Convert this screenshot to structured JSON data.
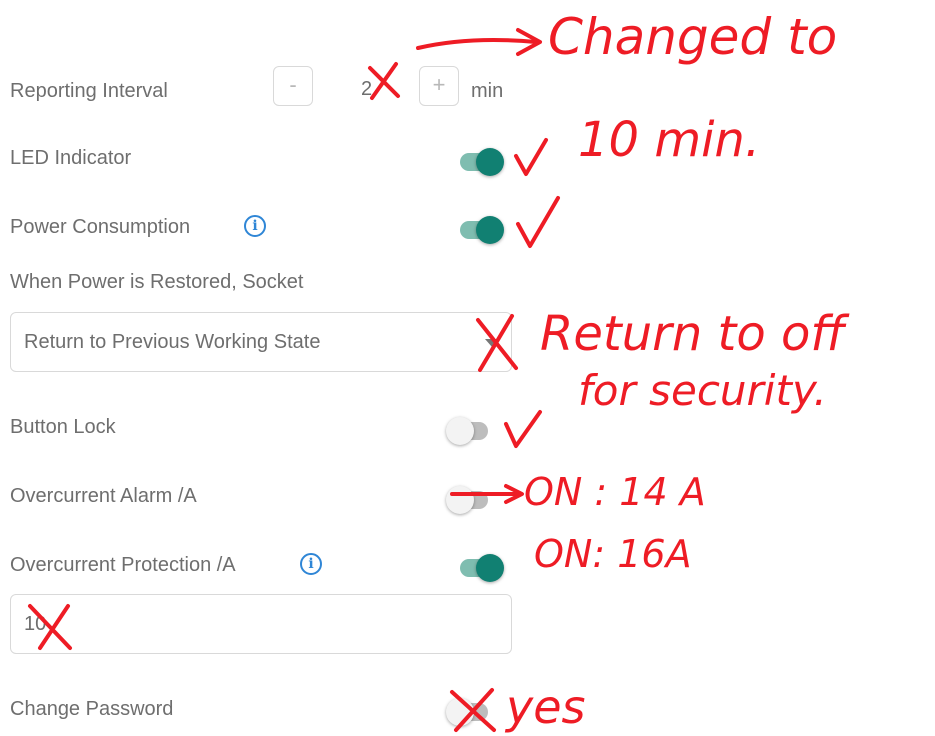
{
  "settings": {
    "reporting_interval": {
      "label": "Reporting Interval",
      "minus": "-",
      "value": "2",
      "plus": "+",
      "unit": "min"
    },
    "led_indicator": {
      "label": "LED Indicator",
      "enabled": true
    },
    "power_consumption": {
      "label": "Power Consumption",
      "enabled": true,
      "info_icon": "info-icon"
    },
    "power_restore": {
      "label": "When Power is Restored, Socket",
      "selected": "Return to Previous Working State"
    },
    "button_lock": {
      "label": "Button Lock",
      "enabled": false
    },
    "overcurrent_alarm": {
      "label": "Overcurrent Alarm /A",
      "enabled": false
    },
    "overcurrent_protection": {
      "label": "Overcurrent Protection /A",
      "enabled": true,
      "info_icon": "info-icon",
      "value": "10"
    },
    "change_password": {
      "label": "Change Password",
      "enabled": false
    }
  },
  "annotations": {
    "interval_note_1": "Changed to",
    "interval_note_2": "10 min.",
    "restore_note_1": "Return to off",
    "restore_note_2": "for security.",
    "alarm_note": "ON : 14 A",
    "protection_note": "ON: 16A",
    "password_note": "yes",
    "color": "#ee1c25"
  },
  "colors": {
    "toggle_on": "#118072",
    "info_icon": "#2f86d6"
  }
}
